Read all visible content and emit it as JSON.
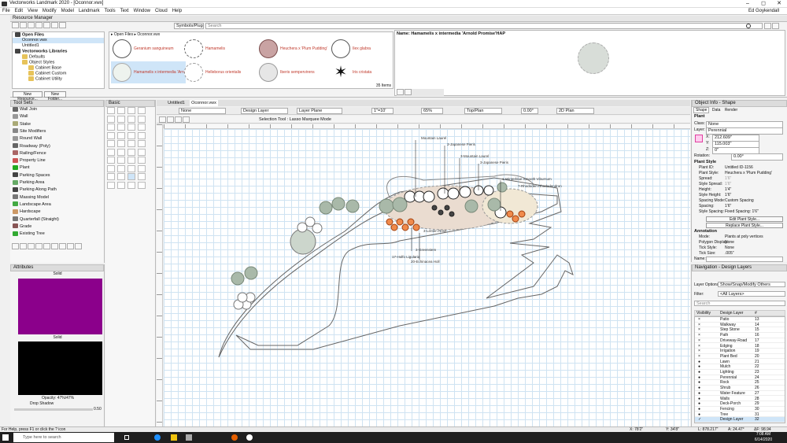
{
  "window": {
    "title": "Vectorworks Landmark 2020 - [Oconnor.vwx]",
    "controls": [
      "–",
      "◻",
      "✕"
    ]
  },
  "menu": [
    "File",
    "Edit",
    "View",
    "Modify",
    "Model",
    "Landmark",
    "Tools",
    "Text",
    "Window",
    "Cloud",
    "Help"
  ],
  "user": "Ed Goykendall",
  "resource_manager": {
    "title": "Resource Manager",
    "search_placeholder": "Search",
    "breadcrumb": [
      "Open Files",
      "Oconnor.vwx"
    ],
    "symbols_filter": "Symbols/Plug-In O",
    "tree": [
      "Open Files",
      "Oconnor.vwx",
      "Untitled1",
      "Vectorworks Libraries",
      "Defaults",
      "Object Styles",
      "Cabinet Base",
      "Cabinet Custom",
      "Cabinet Utility"
    ],
    "symbols": [
      {
        "name": "Geranium sanguineum"
      },
      {
        "name": "Hamamelis"
      },
      {
        "name": "Heuchera x 'Plum Pudding'"
      },
      {
        "name": "Ilex glabra"
      },
      {
        "name": "Hamamelis x intermedia 'Arno..."
      },
      {
        "name": "Helleborus orientalis"
      },
      {
        "name": "Iberis sempervirens"
      },
      {
        "name": "Iris cristata"
      }
    ],
    "count": "35 Items",
    "preview_name": "Name: Hamamelis x intermedia 'Arnold Promise'HAP",
    "new_resource": "New Resource...",
    "new_folder": "New Folder..."
  },
  "tool_sets": {
    "title": "Tool Sets",
    "tools": [
      "Wall Join",
      "Wall",
      "Stake",
      "Site Modifiers",
      "Round Wall",
      "Roadway (Poly)",
      "Railing/Fence",
      "Property Line",
      "Plant",
      "Parking Spaces",
      "Parking Area",
      "Parking Along Path",
      "Massing Model",
      "Landscape Area",
      "Hardscape",
      "Quarterfall (Straight)",
      "Grade",
      "Existing Tree"
    ]
  },
  "basic": {
    "title": "Basic"
  },
  "attributes": {
    "title": "Attributes",
    "fill_label": "Solid",
    "fill_color": "#8b008b",
    "pen_label": "Solid",
    "pen_color": "#000000",
    "opacity": "Opacity: 47%/47%",
    "drop_shadow": "Drop Shadow",
    "line_weight": "0.50"
  },
  "doc_tabs": [
    "Untitled1",
    "Oconnor.vwx"
  ],
  "view_bar": {
    "class": "None",
    "layer": "Design Layer",
    "plane": "Layer Plane",
    "scale": "1\"=10'",
    "zoom": "65%",
    "view": "Top/Plan",
    "rotation": "0.00°",
    "render": "2D Plan"
  },
  "mode_bar": {
    "mode": "Selection Tool : Lasso Marquee Mode"
  },
  "drawing_labels": [
    "Mountain Laurel",
    "3-Japanese Pieris",
    "3-Mountain Laurel",
    "3-Japanese Pieris",
    "1-Winterblue Smooth Viburnum",
    "7-Rhododen Rhododendron",
    "3-Lenten Rose",
    "3-Greenstem",
    "17-Holfo Ligularia",
    "20-Echinacea Holl"
  ],
  "object_info": {
    "title": "Object Info - Shape",
    "tabs": [
      "Shape",
      "Data",
      "Render"
    ],
    "object_type": "Plant",
    "class": "None",
    "layer": "Perennial",
    "x": "212.609\"",
    "y": "115.003\"",
    "z": "0\"",
    "rotation": "0.00°",
    "section_plant_style": "Plant Style",
    "rows": [
      {
        "k": "Plant ID:",
        "v": "Untitled ID-1156"
      },
      {
        "k": "Plant Style:",
        "v": "Heuchera x 'Plum Pudding'"
      },
      {
        "k": "Spread:",
        "v": "1'6\""
      },
      {
        "k": "Style Spread:",
        "v": "1'6\""
      },
      {
        "k": "Height:",
        "v": "1'4\""
      },
      {
        "k": "Style Height:",
        "v": "1'6\""
      },
      {
        "k": "Spacing Mode:",
        "v": "Custom Spacing"
      },
      {
        "k": "Spacing:",
        "v": "1'6\""
      },
      {
        "k": "Style Spacing:",
        "v": "Fixed Spacing: 1'6\""
      }
    ],
    "edit_style": "Edit Plant Style...",
    "replace_style": "Replace Plant Style...",
    "section_annotation": "Annotation",
    "annot_rows": [
      {
        "k": "Mode:",
        "v": "Plants at poly vertices"
      },
      {
        "k": "Polygon Display:",
        "v": "None"
      },
      {
        "k": "Tick Style:",
        "v": "None"
      },
      {
        "k": "Tick Size:",
        "v": ".005\""
      }
    ],
    "name_label": "Name:"
  },
  "navigation": {
    "title": "Navigation - Design Layers",
    "layer_options_label": "Layer Options:",
    "layer_options": "Show/Snap/Modify Others",
    "filter_label": "Filter:",
    "filter": "<All Layers>",
    "search_placeholder": "Search",
    "col_visibility": "Visibility",
    "col_layer": "Design Layer",
    "col_num": "#",
    "layers": [
      {
        "name": "Patio",
        "num": "13",
        "vis": "×"
      },
      {
        "name": "Walkway",
        "num": "14",
        "vis": "×"
      },
      {
        "name": "Step Stone",
        "num": "15",
        "vis": "×"
      },
      {
        "name": "Path",
        "num": "16",
        "vis": "×"
      },
      {
        "name": "Driveway-Road",
        "num": "17",
        "vis": "×"
      },
      {
        "name": "Edging",
        "num": "18",
        "vis": "×"
      },
      {
        "name": "Irrigation",
        "num": "19",
        "vis": "×"
      },
      {
        "name": "Plant Bed",
        "num": "20",
        "vis": "×"
      },
      {
        "name": "Lawn",
        "num": "21",
        "vis": "●"
      },
      {
        "name": "Mulch",
        "num": "22",
        "vis": "●"
      },
      {
        "name": "Lighting",
        "num": "23",
        "vis": "●"
      },
      {
        "name": "Perennial",
        "num": "24",
        "vis": "●"
      },
      {
        "name": "Rock",
        "num": "25",
        "vis": "●"
      },
      {
        "name": "Shrub",
        "num": "26",
        "vis": "●"
      },
      {
        "name": "Water Feature",
        "num": "27",
        "vis": "●"
      },
      {
        "name": "Walls",
        "num": "28",
        "vis": "●"
      },
      {
        "name": "Deck-Porch",
        "num": "29",
        "vis": "●"
      },
      {
        "name": "Fencing",
        "num": "30",
        "vis": "●"
      },
      {
        "name": "Tree",
        "num": "31",
        "vis": "●"
      },
      {
        "name": "Design Layer",
        "num": "32",
        "vis": "✓"
      }
    ]
  },
  "status": {
    "help": "For Help, press F1 or click the ? icon",
    "x": "X: 78'2\"",
    "y": "Y: 34'8\"",
    "l": "L: 878.217\"",
    "a": "A: 24.47°",
    "dx": "ΔF: 98.94 ",
    "time": "7:08 AM",
    "date": "6/14/2020"
  },
  "taskbar": {
    "search": "Type here to search"
  }
}
